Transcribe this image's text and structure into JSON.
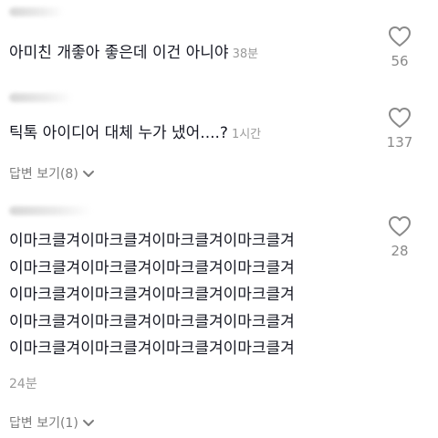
{
  "comments": [
    {
      "text": "아미친 개좋아 좋은데 이건 아니야",
      "time": "38분",
      "likes": "56"
    },
    {
      "text": "틱톡 아이디어 대체 누가 냈어....?",
      "time": "1시간",
      "likes": "137",
      "replies_label": "답변 보기(8)"
    },
    {
      "lines": [
        "이마크클겨이마크클겨이마크클겨이마크클겨",
        "이마크클겨이마크클겨이마크클겨이마크클겨",
        "이마크클겨이마크클겨이마크클겨이마크클겨",
        "이마크클겨이마크클겨이마크클겨이마크클겨",
        "이마크클겨이마크클겨이마크클겨이마크클겨"
      ],
      "time": "24분",
      "likes": "28",
      "replies_label": "답변 보기(1)"
    }
  ],
  "icons": {
    "like": "heart-outline-icon",
    "expand": "chevron-down-icon"
  },
  "colors": {
    "text": "#161823",
    "muted": "#9a9a9a",
    "icon": "#8a8a8a"
  }
}
